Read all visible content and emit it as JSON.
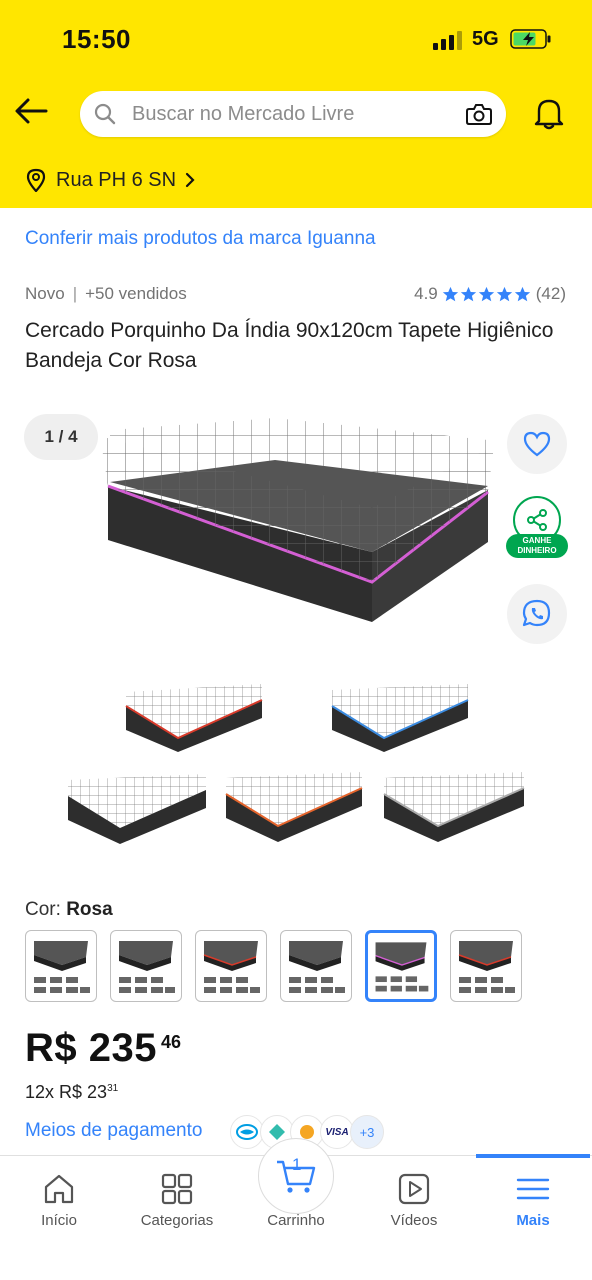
{
  "status_bar": {
    "time": "15:50",
    "network": "5G"
  },
  "header": {
    "search_placeholder": "Buscar no Mercado Livre",
    "address": "Rua PH 6 SN"
  },
  "product": {
    "brand_link": "Conferir mais produtos da marca Iguanna",
    "condition": "Novo",
    "sold": "+50 vendidos",
    "rating": "4.9",
    "reviews": "(42)",
    "title": "Cercado Porquinho Da Índia 90x120cm Tapete Higiênico Bandeja Cor Rosa",
    "gallery_counter": "1 / 4",
    "share_badge_line1": "GANHE",
    "share_badge_line2": "DINHEIRO",
    "color_label": "Cor:",
    "color_value": "Rosa",
    "color_options": [
      "pink",
      "black",
      "red",
      "black-gray",
      "blue-selected",
      "pink-alt"
    ],
    "selected_color_index": 4,
    "price_main": "R$ 235",
    "price_cents": "46",
    "installments_prefix": "12x R$ 23",
    "installments_cents": "31",
    "payment_link": "Meios de pagamento",
    "payment_more": "+3",
    "payment_visa": "VISA"
  },
  "nav": {
    "items": [
      {
        "label": "Início"
      },
      {
        "label": "Categorias"
      },
      {
        "label": "Carrinho"
      },
      {
        "label": "Vídeos"
      },
      {
        "label": "Mais"
      }
    ],
    "cart_count": "1",
    "active_index": 4
  },
  "colors": {
    "brand_yellow": "#ffe600",
    "link_blue": "#3483fa",
    "green": "#00a650"
  }
}
